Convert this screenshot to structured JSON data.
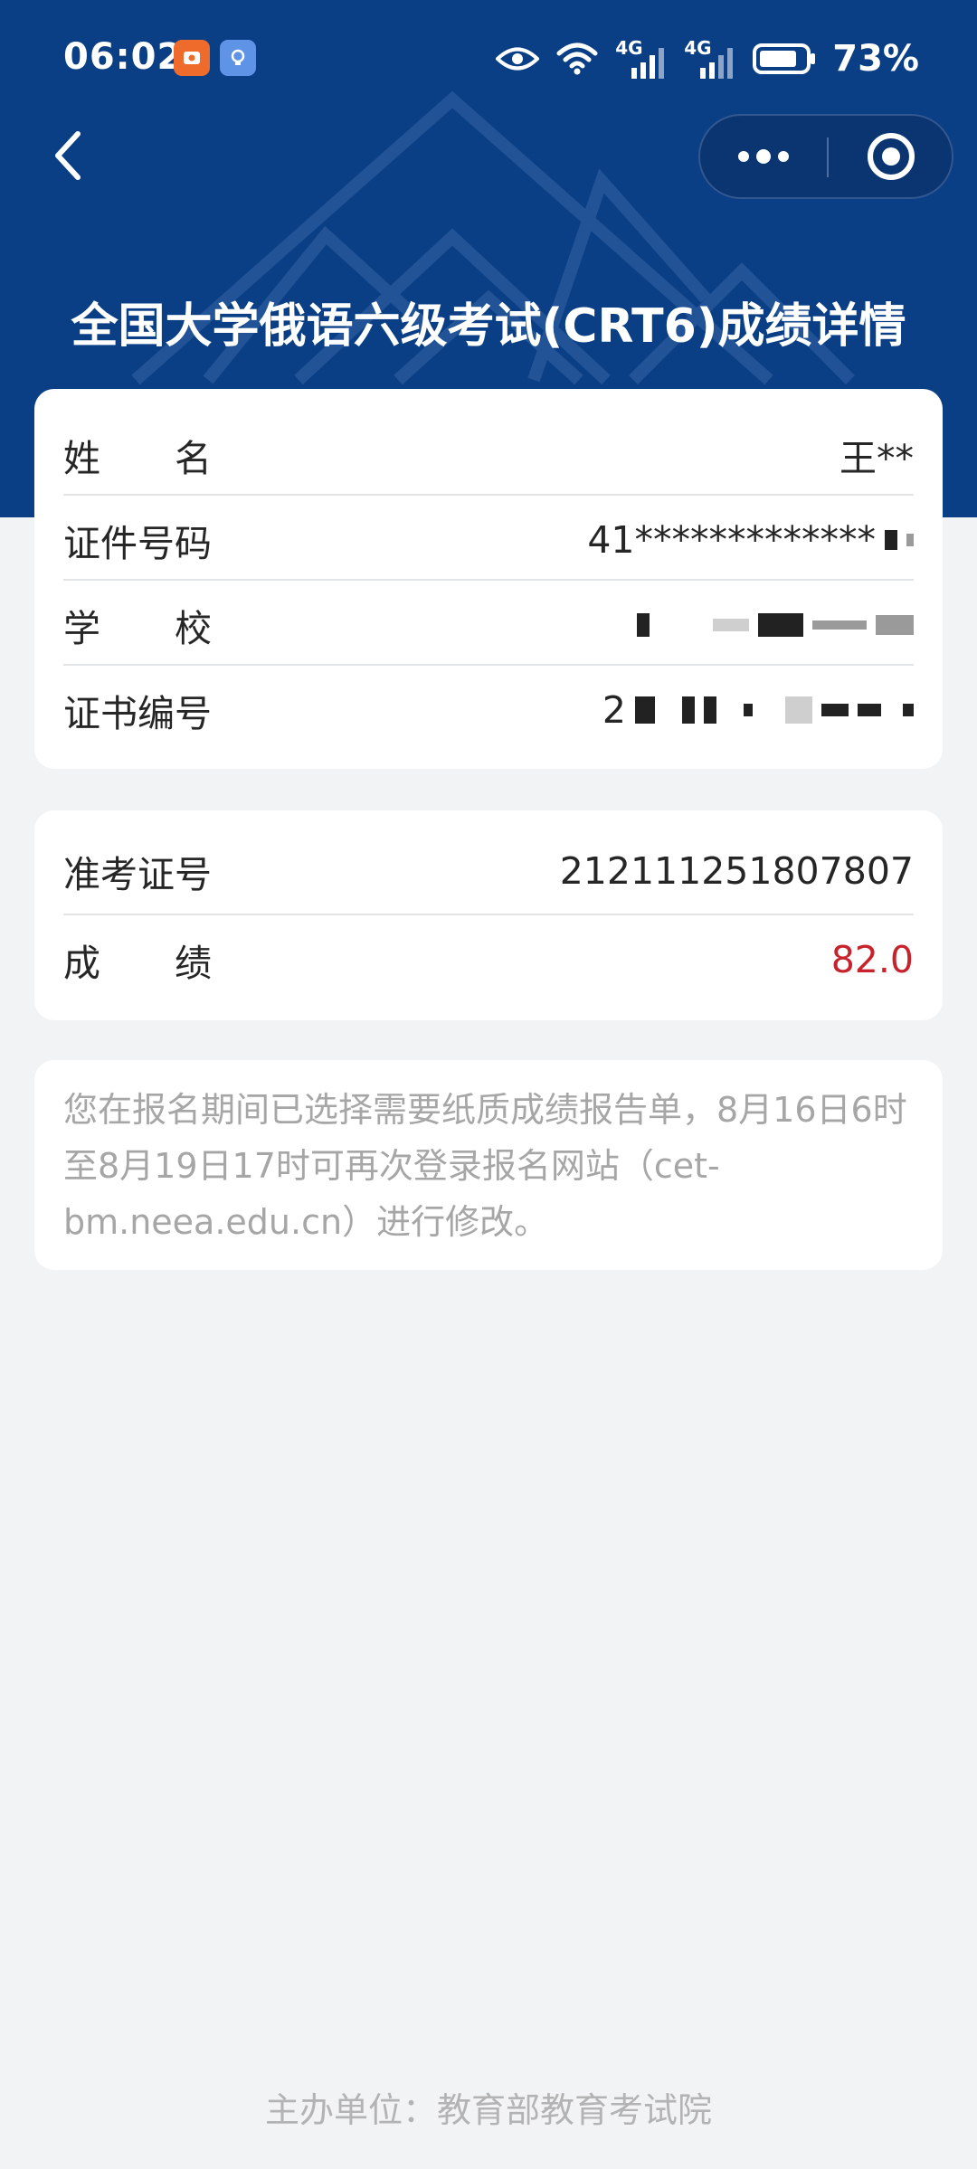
{
  "status_bar": {
    "time": "06:02",
    "network_1": "4G",
    "network_2": "4G",
    "battery": "73%"
  },
  "nav": {
    "back_icon": "chevron-left-icon",
    "more_icon": "more-dots-icon",
    "close_icon": "target-close-icon"
  },
  "title": "全国大学俄语六级考试(CRT6)成绩详情",
  "personal_info": {
    "name_label": "姓　　名",
    "name_value": "王**",
    "id_label": "证件号码",
    "id_value": "41*************",
    "school_label": "学　　校",
    "certificate_label": "证书编号",
    "certificate_value_prefix": "2"
  },
  "exam_info": {
    "ticket_label": "准考证号",
    "ticket_value": "212111251807807",
    "score_label": "成　　绩",
    "score_value": "82.0"
  },
  "notice": "您在报名期间已选择需要纸质成绩报告单，8月16日6时至8月19日17时可再次登录报名网站（cet-bm.neea.edu.cn）进行修改。",
  "footer": "主办单位：教育部教育考试院",
  "colors": {
    "header_blue": "#0a3f86",
    "score_red": "#c8232c",
    "background": "#f2f3f5"
  }
}
